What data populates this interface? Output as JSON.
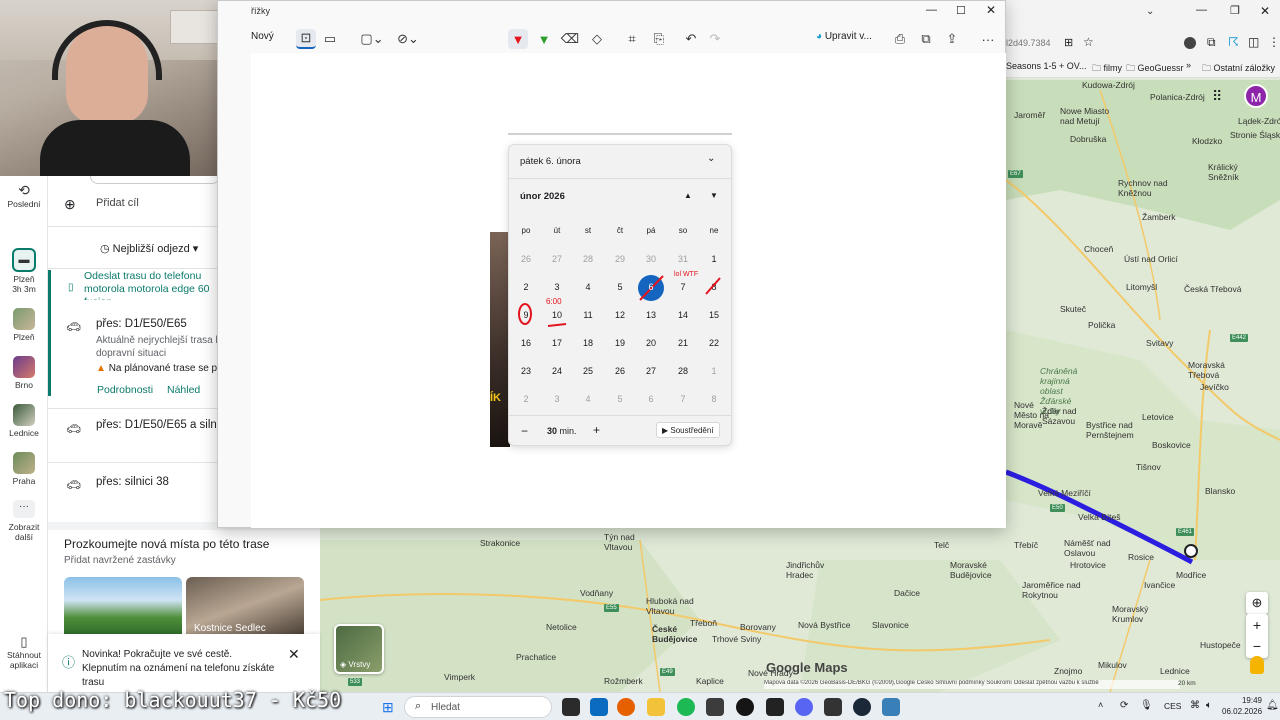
{
  "snip": {
    "title": "řížky",
    "new_label": "Nový",
    "edit_label": "Upravit v..."
  },
  "calendar": {
    "header_date": "pátek 6. února",
    "month_label": "únor 2026",
    "weekdays": [
      "po",
      "út",
      "st",
      "čt",
      "pá",
      "so",
      "ne"
    ],
    "weeks": [
      [
        "26",
        "27",
        "28",
        "29",
        "30",
        "31",
        "1"
      ],
      [
        "2",
        "3",
        "4",
        "5",
        "6",
        "7",
        "8"
      ],
      [
        "9",
        "10",
        "11",
        "12",
        "13",
        "14",
        "15"
      ],
      [
        "16",
        "17",
        "18",
        "19",
        "20",
        "21",
        "22"
      ],
      [
        "23",
        "24",
        "25",
        "26",
        "27",
        "28",
        "1"
      ],
      [
        "2",
        "3",
        "4",
        "5",
        "6",
        "7",
        "8"
      ]
    ],
    "focus_minutes": "30",
    "focus_unit": "min.",
    "focus_button": "Soustředění"
  },
  "maps_panel": {
    "add_destination": "Přidat cíl",
    "departure_label": "Nejbližší odjezd",
    "send_route_1": "Odeslat trasu do telefonu",
    "send_route_2": "motorola motorola edge 60",
    "send_route_3": "fusion",
    "routes": [
      {
        "title": "přes: D1/E50/E65",
        "line1": "Aktuálně nejrychlejší trasa k",
        "line2": "dopravní situaci",
        "warning": "Na plánované trase se p",
        "details": "Podrobnosti",
        "preview": "Náhled"
      },
      {
        "title": "přes: D1/E50/E65 a silnic"
      },
      {
        "title": "přes: silnici 38"
      }
    ],
    "explore_title": "Prozkoumejte nová místa po této trase",
    "explore_sub": "Přidat navržené zastávky",
    "card2_label": "Kostnice Sedlec",
    "notice": "Novinka! Pokračujte ve své cestě. Klepnutím na oznámení na telefonu získáte trasu"
  },
  "rail": {
    "recent": "Poslední",
    "items": [
      {
        "label": "Plzeň",
        "sub": "3h 3m"
      },
      {
        "label": "Plzeň"
      },
      {
        "label": "Brno"
      },
      {
        "label": "Lednice"
      },
      {
        "label": "Praha"
      }
    ],
    "more": "Zobrazit další",
    "download": "Stáhnout aplikaci"
  },
  "browser": {
    "url_fragment": "l2d49.7384",
    "bookmarks": [
      "Seasons 1-5 + OV...",
      "filmy",
      "GeoGuessr",
      "Ostatní záložky"
    ],
    "avatar_letter": "M"
  },
  "map": {
    "towns": [
      "Kudowa-Zdrój",
      "Polanica-Zdrój",
      "Lądek-Zdrój",
      "Nowe Miasto nad Metují",
      "Kłodzko",
      "Stronie Śląskie",
      "Jaroměř",
      "Dobruška",
      "Králický Sněžník",
      "Rychnov nad Kněžnou",
      "Žamberk",
      "Choceň",
      "Ústí nad Orlicí",
      "Litomyšl",
      "Česká Třebová",
      "Skuteč",
      "Polička",
      "Svitavy",
      "Moravská Třebová",
      "Chráněná krajinná oblast Žďárské vrchy",
      "Jevíčko",
      "Žďár nad Sázavou",
      "Nové Město na Moravě",
      "Letovice",
      "Bystřice nad Pernštejnem",
      "Boskovice",
      "Tišnov",
      "Blansko",
      "Velké Meziříčí",
      "Velká Bíteš",
      "Třebíč",
      "Náměšť nad Oslavou",
      "Rosice",
      "Ivančice",
      "Moravský Krumlov",
      "Jaroměřice nad Rokytnou",
      "Moravské Budějovice",
      "Hrotovice",
      "Jindřichův Hradec",
      "Telč",
      "Dačice",
      "Nová Bystřice",
      "Slavonice",
      "Třeboň",
      "Nové Hrady",
      "Hluboká nad Vltavou",
      "Týn nad Vltavou",
      "Vodňany",
      "Strakonice",
      "Netolice",
      "Prachatice",
      "Vimperk",
      "České Budějovice",
      "Kaplice",
      "Trhové Sviny",
      "Borovany",
      "Rožmberk",
      "Znojmo",
      "Hustopeče",
      "Mikulov",
      "Modřice",
      "Lednice"
    ],
    "road_numbers": [
      "E67",
      "E442",
      "E461",
      "E50",
      "533",
      "E49",
      "E55"
    ],
    "layers_label": "Vrstvy",
    "attribution": "Mapová data ©2026 GeoBasis-DE/BKG (©2009),Google  Česko  Smluvní podmínky  Soukromí  Odeslat zpětnou vazbu k službě",
    "scale": "20 km",
    "brand": "Google Maps"
  },
  "taskbar": {
    "search": "Hledat",
    "lang": "CES",
    "time": "19:49",
    "date": "06.02.2026"
  },
  "overlay": {
    "donation": "Top dono: blackouut37 - Kč50"
  },
  "annotations": {
    "mark_6": "6:00",
    "mark_7": "lol WTF"
  },
  "colors": {
    "route": "#2b1ee0",
    "accent_teal": "#0a7a6a",
    "selected_day": "#1565c0",
    "ink_red": "#e3151f"
  }
}
